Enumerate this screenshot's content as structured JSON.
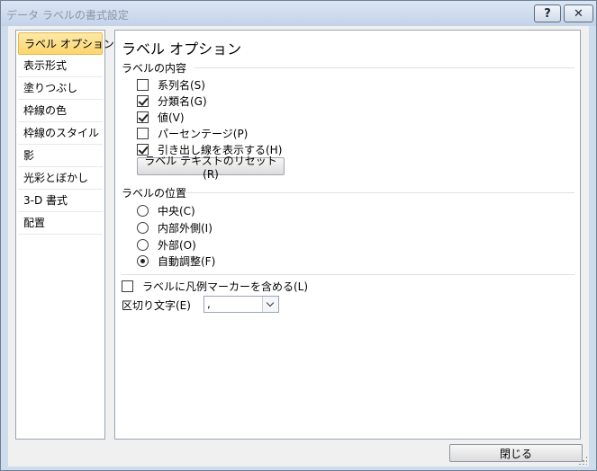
{
  "window": {
    "title": "データ ラベルの書式設定",
    "help_label": "?",
    "close_label": "✕"
  },
  "nav": {
    "items": [
      {
        "label": "ラベル オプション"
      },
      {
        "label": "表示形式"
      },
      {
        "label": "塗りつぶし"
      },
      {
        "label": "枠線の色"
      },
      {
        "label": "枠線のスタイル"
      },
      {
        "label": "影"
      },
      {
        "label": "光彩とぼかし"
      },
      {
        "label": "3-D 書式"
      },
      {
        "label": "配置"
      }
    ],
    "selected": "ラベル オプション"
  },
  "panel": {
    "title": "ラベル オプション",
    "contents": {
      "heading": "ラベルの内容",
      "options": [
        {
          "label": "系列名(S)",
          "checked": false
        },
        {
          "label": "分類名(G)",
          "checked": true
        },
        {
          "label": "値(V)",
          "checked": true
        },
        {
          "label": "パーセンテージ(P)",
          "checked": false
        },
        {
          "label": "引き出し線を表示する(H)",
          "checked": true
        }
      ],
      "reset_label": "ラベル テキストのリセット(R)"
    },
    "position": {
      "heading": "ラベルの位置",
      "options": [
        {
          "label": "中央(C)",
          "checked": false
        },
        {
          "label": "内部外側(I)",
          "checked": false
        },
        {
          "label": "外部(O)",
          "checked": false
        },
        {
          "label": "自動調整(F)",
          "checked": true
        }
      ]
    },
    "legend_key": {
      "label": "ラベルに凡例マーカーを含める(L)",
      "checked": false
    },
    "separator": {
      "label": "区切り文字(E)",
      "value": ","
    }
  },
  "footer": {
    "close_label": "閉じる"
  }
}
